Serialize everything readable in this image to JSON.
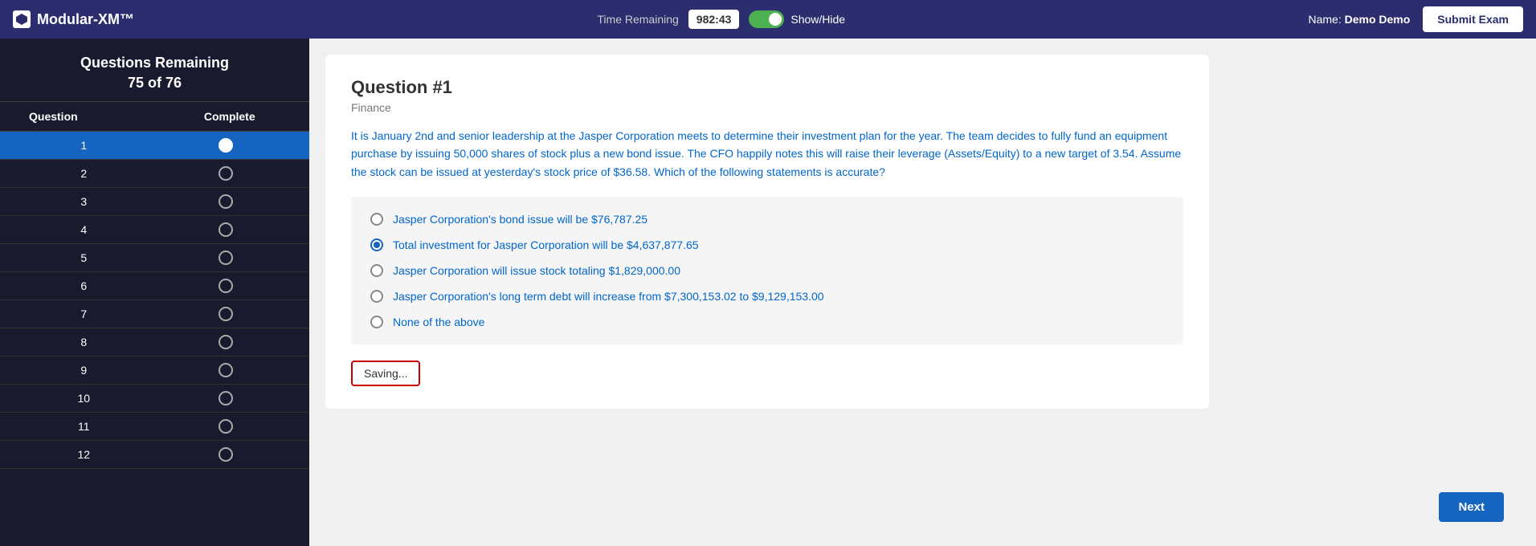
{
  "header": {
    "logo_text": "Modular-XM™",
    "time_label": "Time Remaining",
    "time_value": "982:43",
    "show_hide_label": "Show/Hide",
    "user_label": "Name:",
    "user_name": "Demo Demo",
    "submit_label": "Submit Exam"
  },
  "sidebar": {
    "title": "Questions Remaining",
    "subtitle": "75 of 76",
    "col_question": "Question",
    "col_complete": "Complete",
    "rows": [
      {
        "num": "1",
        "active": true,
        "filled": true
      },
      {
        "num": "2",
        "active": false,
        "filled": false
      },
      {
        "num": "3",
        "active": false,
        "filled": false
      },
      {
        "num": "4",
        "active": false,
        "filled": false
      },
      {
        "num": "5",
        "active": false,
        "filled": false
      },
      {
        "num": "6",
        "active": false,
        "filled": false
      },
      {
        "num": "7",
        "active": false,
        "filled": false
      },
      {
        "num": "8",
        "active": false,
        "filled": false
      },
      {
        "num": "9",
        "active": false,
        "filled": false
      },
      {
        "num": "10",
        "active": false,
        "filled": false
      },
      {
        "num": "11",
        "active": false,
        "filled": false
      },
      {
        "num": "12",
        "active": false,
        "filled": false
      }
    ]
  },
  "question": {
    "title": "Question #1",
    "category": "Finance",
    "text": "It is January 2nd and senior leadership at the Jasper Corporation meets to determine their investment plan for the year. The team decides to fully fund an equipment purchase by issuing 50,000 shares of stock plus a new bond issue. The CFO happily notes this will raise their leverage (Assets/Equity) to a new target of 3.54. Assume the stock can be issued at yesterday's stock price of $36.58. Which of the following statements is accurate?",
    "answers": [
      {
        "id": "a",
        "text": "Jasper Corporation's bond issue will be $76,787.25",
        "selected": false
      },
      {
        "id": "b",
        "text": "Total investment for Jasper Corporation will be $4,637,877.65",
        "selected": true
      },
      {
        "id": "c",
        "text": "Jasper Corporation will issue stock totaling $1,829,000.00",
        "selected": false
      },
      {
        "id": "d",
        "text": "Jasper Corporation's long term debt will increase from $7,300,153.02 to $9,129,153.00",
        "selected": false
      },
      {
        "id": "e",
        "text": "None of the above",
        "selected": false
      }
    ],
    "saving_label": "Saving...",
    "next_label": "Next"
  }
}
